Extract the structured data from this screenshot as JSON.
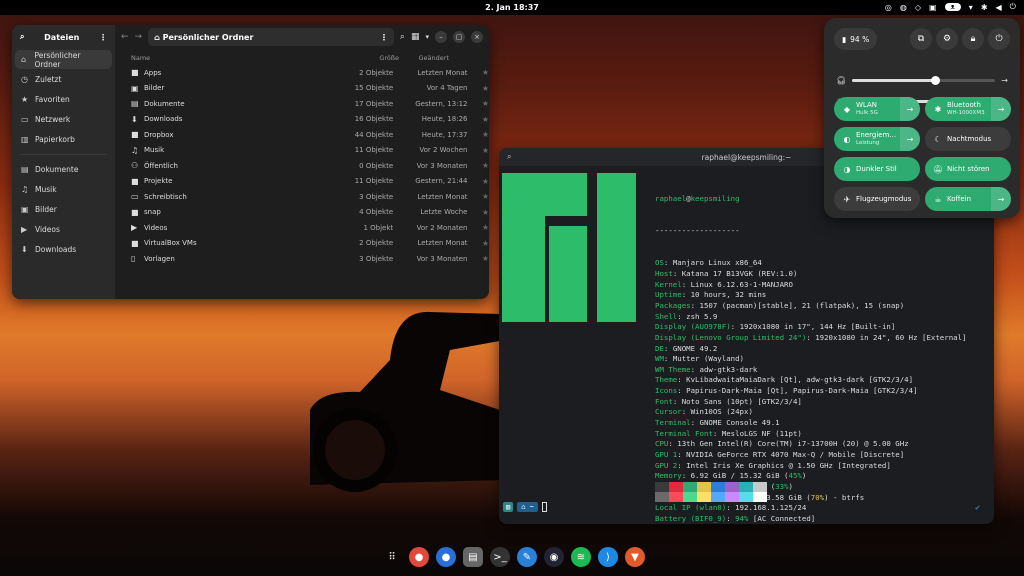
{
  "topbar": {
    "clock": "2. Jan  18:37",
    "battery_pill": "ᴥ"
  },
  "files": {
    "app_title": "Dateien",
    "sidebar": [
      {
        "label": "Persönlicher Ordner",
        "icon": "home-icon",
        "glyph": "⌂"
      },
      {
        "label": "Zuletzt",
        "icon": "clock-icon",
        "glyph": "◷"
      },
      {
        "label": "Favoriten",
        "icon": "star-icon",
        "glyph": "★"
      },
      {
        "label": "Netzwerk",
        "icon": "network-icon",
        "glyph": "▭"
      },
      {
        "label": "Papierkorb",
        "icon": "trash-icon",
        "glyph": "▥"
      }
    ],
    "sidebar2": [
      {
        "label": "Dokumente",
        "icon": "document-icon",
        "glyph": "▤"
      },
      {
        "label": "Musik",
        "icon": "music-icon",
        "glyph": "♫"
      },
      {
        "label": "Bilder",
        "icon": "image-icon",
        "glyph": "▣"
      },
      {
        "label": "Videos",
        "icon": "video-icon",
        "glyph": "▶"
      },
      {
        "label": "Downloads",
        "icon": "download-icon",
        "glyph": "⬇"
      }
    ],
    "path": "Persönlicher Ordner",
    "columns": {
      "name": "Name",
      "size": "Größe",
      "modified": "Geändert"
    },
    "rows": [
      {
        "name": "Apps",
        "size": "2 Objekte",
        "modified": "Letzten Monat",
        "glyph": "■"
      },
      {
        "name": "Bilder",
        "size": "15 Objekte",
        "modified": "Vor 4 Tagen",
        "glyph": "▣"
      },
      {
        "name": "Dokumente",
        "size": "17 Objekte",
        "modified": "Gestern, 13:12",
        "glyph": "▤"
      },
      {
        "name": "Downloads",
        "size": "16 Objekte",
        "modified": "Heute, 18:26",
        "glyph": "⬇"
      },
      {
        "name": "Dropbox",
        "size": "44 Objekte",
        "modified": "Heute, 17:37",
        "glyph": "■"
      },
      {
        "name": "Musik",
        "size": "11 Objekte",
        "modified": "Vor 2 Wochen",
        "glyph": "♫"
      },
      {
        "name": "Öffentlich",
        "size": "0 Objekte",
        "modified": "Vor 3 Monaten",
        "glyph": "⚇"
      },
      {
        "name": "Projekte",
        "size": "11 Objekte",
        "modified": "Gestern, 21:44",
        "glyph": "■"
      },
      {
        "name": "Schreibtisch",
        "size": "3 Objekte",
        "modified": "Letzten Monat",
        "glyph": "▭"
      },
      {
        "name": "snap",
        "size": "4 Objekte",
        "modified": "Letzte Woche",
        "glyph": "■"
      },
      {
        "name": "Videos",
        "size": "1 Objekt",
        "modified": "Vor 2 Monaten",
        "glyph": "▶"
      },
      {
        "name": "VirtualBox VMs",
        "size": "2 Objekte",
        "modified": "Letzten Monat",
        "glyph": "■"
      },
      {
        "name": "Vorlagen",
        "size": "3 Objekte",
        "modified": "Vor 3 Monaten",
        "glyph": "▯"
      }
    ]
  },
  "terminal": {
    "title": "raphael@keepsmiling:~",
    "user": "raphael",
    "host": "keepsmiling",
    "separator": "-------------------",
    "lines": [
      {
        "k": "OS",
        "v": "Manjaro Linux x86_64"
      },
      {
        "k": "Host",
        "v": "Katana 17 B13VGK (REV:1.0)"
      },
      {
        "k": "Kernel",
        "v": "Linux 6.12.63-1-MANJARO"
      },
      {
        "k": "Uptime",
        "v": "10 hours, 32 mins"
      },
      {
        "k": "Packages",
        "v": "1507 (pacman)[stable], 21 (flatpak), 15 (snap)"
      },
      {
        "k": "Shell",
        "v": "zsh 5.9"
      },
      {
        "k": "Display (AUO978F)",
        "v": "1920x1080 in 17\", 144 Hz [Built-in]"
      },
      {
        "k": "Display (Lenovo Group Limited 24\")",
        "v": "1920x1080 in 24\", 60 Hz [External]"
      },
      {
        "k": "DE",
        "v": "GNOME 49.2"
      },
      {
        "k": "WM",
        "v": "Mutter (Wayland)"
      },
      {
        "k": "WM Theme",
        "v": "adw-gtk3-dark"
      },
      {
        "k": "Theme",
        "v": "KvLibadwaitaMaiaDark [Qt], adw-gtk3-dark [GTK2/3/4]"
      },
      {
        "k": "Icons",
        "v": "Papirus-Dark-Maia [Qt], Papirus-Dark-Maia [GTK2/3/4]"
      },
      {
        "k": "Font",
        "v": "Noto Sans (10pt) [GTK2/3/4]"
      },
      {
        "k": "Cursor",
        "v": "Win10OS (24px)"
      },
      {
        "k": "Terminal",
        "v": "GNOME Console 49.1"
      },
      {
        "k": "Terminal Font",
        "v": "MesloLGS NF (11pt)"
      },
      {
        "k": "CPU",
        "v": "13th Gen Intel(R) Core(TM) i7-13700H (20) @ 5.00 GHz"
      },
      {
        "k": "GPU 1",
        "v": "NVIDIA GeForce RTX 4070 Max-Q / Mobile [Discrete]"
      },
      {
        "k": "GPU 2",
        "v": "Intel Iris Xe Graphics @ 1.50 GHz [Integrated]"
      },
      {
        "k": "Memory",
        "v": "6.92 GiB / 15.32 GiB (",
        "p": "45%",
        "pc": "g",
        "e": ")"
      },
      {
        "k": "Swap",
        "v": "2.54 GiB / 7.66 GiB (",
        "p": "33%",
        "pc": "g",
        "e": ")"
      },
      {
        "k": "Disk (/)",
        "v": "670.38 GiB / 953.58 GiB (",
        "p": "70%",
        "pc": "y",
        "e": ") - btrfs"
      },
      {
        "k": "Local IP (wlan0)",
        "v": "192.168.1.125/24"
      },
      {
        "k": "Battery (BIF0_9)",
        "v": "",
        "p": "94%",
        "pc": "g",
        "e": " [AC Connected]"
      },
      {
        "k": "Locale",
        "v": "de_DE.UTF-8"
      }
    ],
    "palette": [
      "#3a3a3a",
      "#e02b3c",
      "#2dab71",
      "#e3c14a",
      "#2a7fd6",
      "#a060c8",
      "#2ab0b8",
      "#c8c8c8",
      "#6a6a6a",
      "#ff4a5a",
      "#4fd88e",
      "#ffe066",
      "#58a6ff",
      "#c88aff",
      "#56dde5",
      "#ffffff"
    ],
    "prompt_icon": "⌂",
    "prompt_dir": "~",
    "logo_color": "#2dbd6a"
  },
  "quick": {
    "battery": "94 %",
    "top_icons": [
      {
        "name": "screenshot-icon",
        "glyph": "⧉"
      },
      {
        "name": "settings-icon",
        "glyph": "⚙"
      },
      {
        "name": "lock-icon",
        "glyph": "🔒︎"
      },
      {
        "name": "power-icon",
        "glyph": "⏻"
      }
    ],
    "volume_level": 0.58,
    "brightness_level": 0.78,
    "tiles": [
      {
        "title": "WLAN",
        "sub": "Hulk 5G",
        "on": true,
        "arrow": true,
        "glyph": "◆"
      },
      {
        "title": "Bluetooth",
        "sub": "WH-1000XM3",
        "on": true,
        "arrow": true,
        "glyph": "✱"
      },
      {
        "title": "Energiem...",
        "sub": "Leistung",
        "on": true,
        "arrow": true,
        "glyph": "◐"
      },
      {
        "title": "Nachtmodus",
        "sub": "",
        "on": false,
        "arrow": false,
        "glyph": "☾"
      },
      {
        "title": "Dunkler Stil",
        "sub": "",
        "on": true,
        "arrow": false,
        "glyph": "◑"
      },
      {
        "title": "Nicht stören",
        "sub": "",
        "on": true,
        "arrow": false,
        "glyph": "🔕︎"
      },
      {
        "title": "Flugzeugmodus",
        "sub": "",
        "on": false,
        "arrow": false,
        "glyph": "✈"
      },
      {
        "title": "Koffein",
        "sub": "",
        "on": true,
        "arrow": true,
        "glyph": "☕︎"
      }
    ]
  },
  "dock": [
    {
      "name": "app-grid-icon",
      "glyph": "⠿",
      "bg": "transparent"
    },
    {
      "name": "chrome-icon",
      "glyph": "●",
      "bg": "#e04a3a"
    },
    {
      "name": "browser-icon",
      "glyph": "●",
      "bg": "#2a6fd6"
    },
    {
      "name": "files-icon",
      "glyph": "▤",
      "bg": "#666"
    },
    {
      "name": "terminal-icon",
      "glyph": ">_",
      "bg": "#333"
    },
    {
      "name": "editor-icon",
      "glyph": "✎",
      "bg": "#2a7fd6"
    },
    {
      "name": "obs-icon",
      "glyph": "◉",
      "bg": "#223"
    },
    {
      "name": "spotify-icon",
      "glyph": "≋",
      "bg": "#1db954"
    },
    {
      "name": "vscode-icon",
      "glyph": "⟩",
      "bg": "#1e88e5"
    },
    {
      "name": "brave-icon",
      "glyph": "▼",
      "bg": "#e05a2a"
    }
  ]
}
